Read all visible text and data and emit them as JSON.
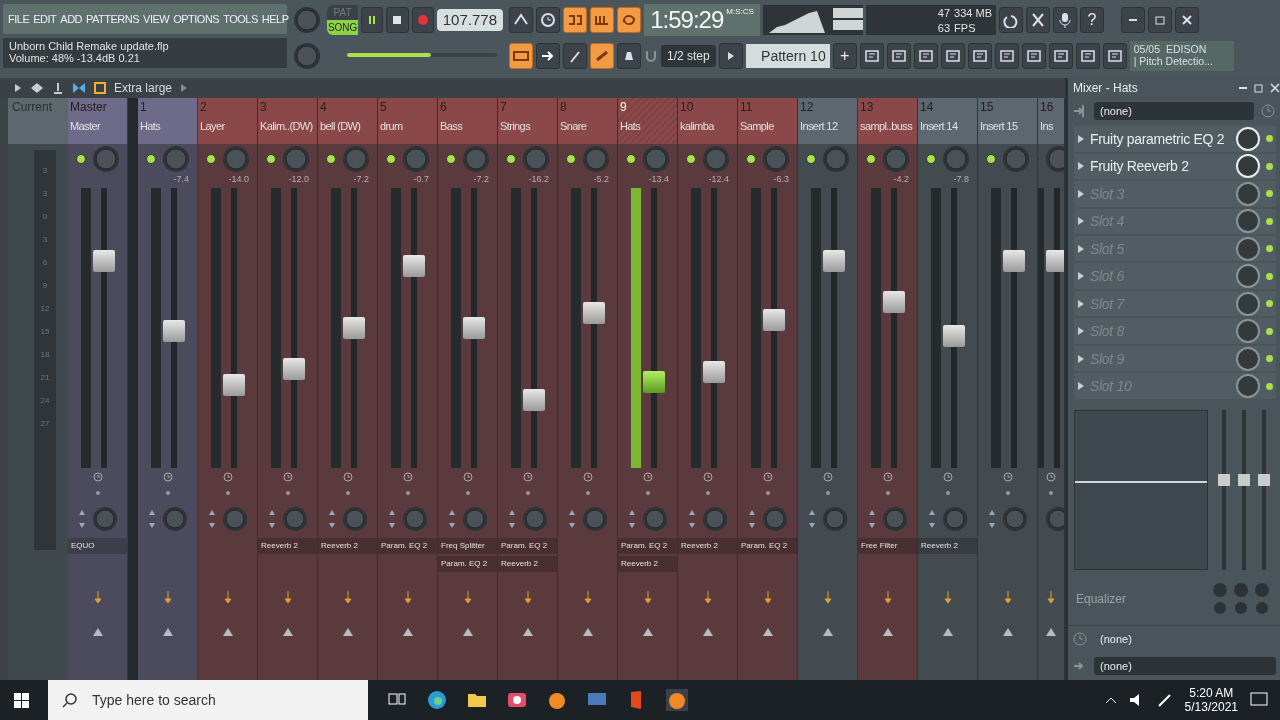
{
  "menu": [
    "FILE",
    "EDIT",
    "ADD",
    "PATTERNS",
    "VIEW",
    "OPTIONS",
    "TOOLS",
    "HELP"
  ],
  "hint": {
    "title": "Unborn Child Remake update.flp",
    "detail": "Volume: 48%  -13.4dB  0.21"
  },
  "transport": {
    "modes": [
      {
        "label": "PAT",
        "selected": false
      },
      {
        "label": "SONG",
        "selected": true
      }
    ],
    "tempo": "107.778",
    "master_volume": {
      "level": 0.56
    }
  },
  "time": {
    "value": "1:59:29",
    "unit": "M:S:CS"
  },
  "performance": {
    "cpu": "47",
    "memory": "334 MB",
    "fps": "63",
    "fps_label": "FPS"
  },
  "help": "?",
  "snap": "1/2 step",
  "pattern": {
    "name": "Pattern 10",
    "add": "+"
  },
  "news": {
    "count": "05/05",
    "title": "EDISON",
    "subtitle": "| Pitch Detectio..."
  },
  "mixer_toolbar": {
    "view": "Extra large"
  },
  "current": {
    "label": "Current",
    "value": "3",
    "scale": [
      "3",
      "0",
      "3",
      "6",
      "9",
      "12",
      "15",
      "18",
      "21",
      "24",
      "27"
    ]
  },
  "strips": [
    {
      "number": "Master",
      "name": "Master",
      "color": "#6e6a8a",
      "selected": false,
      "level": 0.76,
      "slots": [
        "EQUO"
      ]
    },
    {
      "number": "1",
      "name": "Hats",
      "color": "#6e6a8a",
      "selected": false,
      "reading": "-7.4",
      "level": 0.49
    },
    {
      "number": "2",
      "name": "Layer",
      "color": "#8a4848",
      "selected": false,
      "reading": "-14.0",
      "level": 0.28
    },
    {
      "number": "3",
      "name": "Kalim..(DW)",
      "color": "#8a4848",
      "selected": false,
      "reading": "-12.0",
      "level": 0.34,
      "slots": [
        "Reeverb 2"
      ]
    },
    {
      "number": "4",
      "name": "bell (DW)",
      "color": "#8a4848",
      "selected": false,
      "reading": "-7.2",
      "level": 0.5,
      "slots": [
        "Reeverb 2"
      ]
    },
    {
      "number": "5",
      "name": "drum",
      "color": "#8a4848",
      "selected": false,
      "reading": "-0.7",
      "level": 0.74,
      "slots": [
        "Param. EQ 2"
      ]
    },
    {
      "number": "6",
      "name": "Bass",
      "color": "#8a4848",
      "selected": false,
      "reading": "-7.2",
      "level": 0.5,
      "slots": [
        "Freq Splitter",
        "Param. EQ 2"
      ]
    },
    {
      "number": "7",
      "name": "Strings",
      "color": "#8a4848",
      "selected": false,
      "reading": "-16.2",
      "level": 0.22,
      "slots": [
        "Param. EQ 2",
        "Reeverb 2"
      ]
    },
    {
      "number": "8",
      "name": "Snare",
      "color": "#8a4848",
      "selected": false,
      "reading": "-5.2",
      "level": 0.56
    },
    {
      "number": "9",
      "name": "Hats",
      "color": "#8a4848",
      "selected": true,
      "reading": "-13.4",
      "level": 0.29,
      "slots": [
        "Param. EQ 2",
        "Reeverb 2"
      ]
    },
    {
      "number": "10",
      "name": "kalimba",
      "color": "#8a4848",
      "selected": false,
      "reading": "-12.4",
      "level": 0.33,
      "slots": [
        "Reeverb 2"
      ]
    },
    {
      "number": "11",
      "name": "Sample",
      "color": "#8a4848",
      "selected": false,
      "reading": "-6.3",
      "level": 0.53,
      "slots": [
        "Param. EQ 2"
      ]
    },
    {
      "number": "12",
      "name": "Insert 12",
      "color": "#5c6770",
      "selected": false,
      "level": 0.76
    },
    {
      "number": "13",
      "name": "sampl..buss",
      "color": "#8a4848",
      "selected": false,
      "reading": "-4.2",
      "level": 0.6,
      "slots": [
        "Free Filter"
      ]
    },
    {
      "number": "14",
      "name": "Insert 14",
      "color": "#5c6770",
      "selected": false,
      "reading": "-7.8",
      "level": 0.47,
      "slots": [
        "Reeverb 2"
      ]
    },
    {
      "number": "15",
      "name": "Insert 15",
      "color": "#5c6770",
      "selected": false,
      "level": 0.76
    },
    {
      "number": "16",
      "name": "Ins",
      "color": "#5c6770",
      "selected": false,
      "level": 0.76
    }
  ],
  "panel": {
    "title": "Mixer - Hats",
    "input": "(none)",
    "slots": [
      {
        "name": "Fruity parametric EQ 2",
        "empty": false
      },
      {
        "name": "Fruity Reeverb 2",
        "empty": false
      },
      {
        "name": "Slot 3",
        "empty": true
      },
      {
        "name": "Slot 4",
        "empty": true
      },
      {
        "name": "Slot 5",
        "empty": true
      },
      {
        "name": "Slot 6",
        "empty": true
      },
      {
        "name": "Slot 7",
        "empty": true
      },
      {
        "name": "Slot 8",
        "empty": true
      },
      {
        "name": "Slot 9",
        "empty": true
      },
      {
        "name": "Slot 10",
        "empty": true
      }
    ],
    "eq_label": "Equalizer",
    "latency": "(none)",
    "output": "(none)"
  },
  "taskbar": {
    "search_placeholder": "Type here to search",
    "time": "5:20 AM",
    "date": "5/13/2021"
  }
}
